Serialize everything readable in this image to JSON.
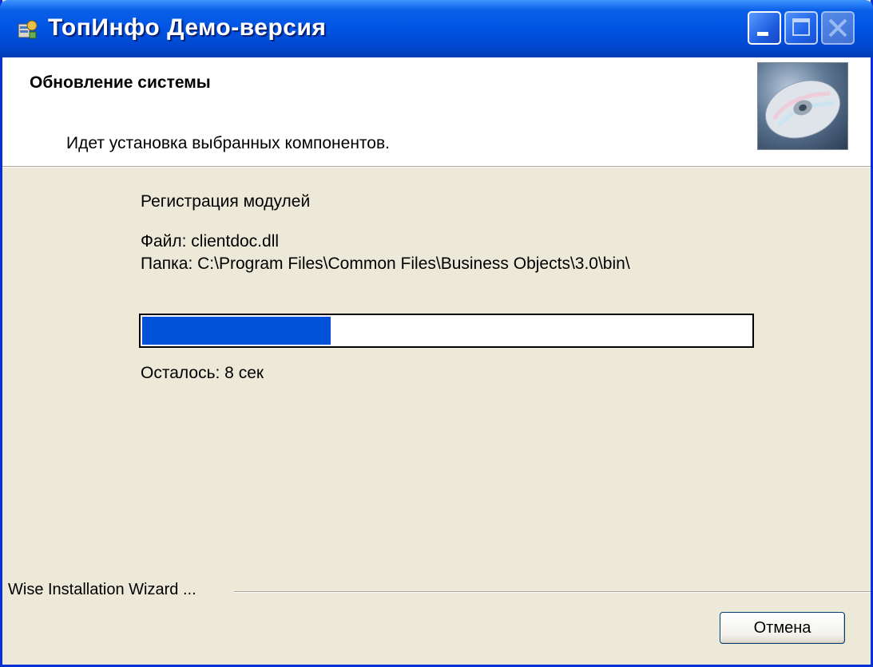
{
  "window": {
    "title": "ТопИнфо Демо-версия",
    "app_icon": "installer-icon",
    "controls": [
      "minimize-icon",
      "maximize-icon",
      "close-icon"
    ]
  },
  "header": {
    "title": "Обновление системы",
    "subtitle": "Идет установка выбранных компонентов.",
    "image": "cd-disc-icon"
  },
  "main": {
    "action": "Регистрация модулей",
    "file_line": "Файл: clientdoc.dll",
    "folder_line": "Папка: C:\\Program Files\\Common Files\\Business Objects\\3.0\\bin\\",
    "progress_fraction": 0.31,
    "remaining": "Осталось: 8 сек"
  },
  "footer": {
    "brand": "Wise Installation Wizard ...",
    "cancel_label": "Отмена"
  },
  "colors": {
    "titlebar": "#0054e3",
    "progress_fill": "#0051d8",
    "dialog_bg": "#ece9d8"
  }
}
